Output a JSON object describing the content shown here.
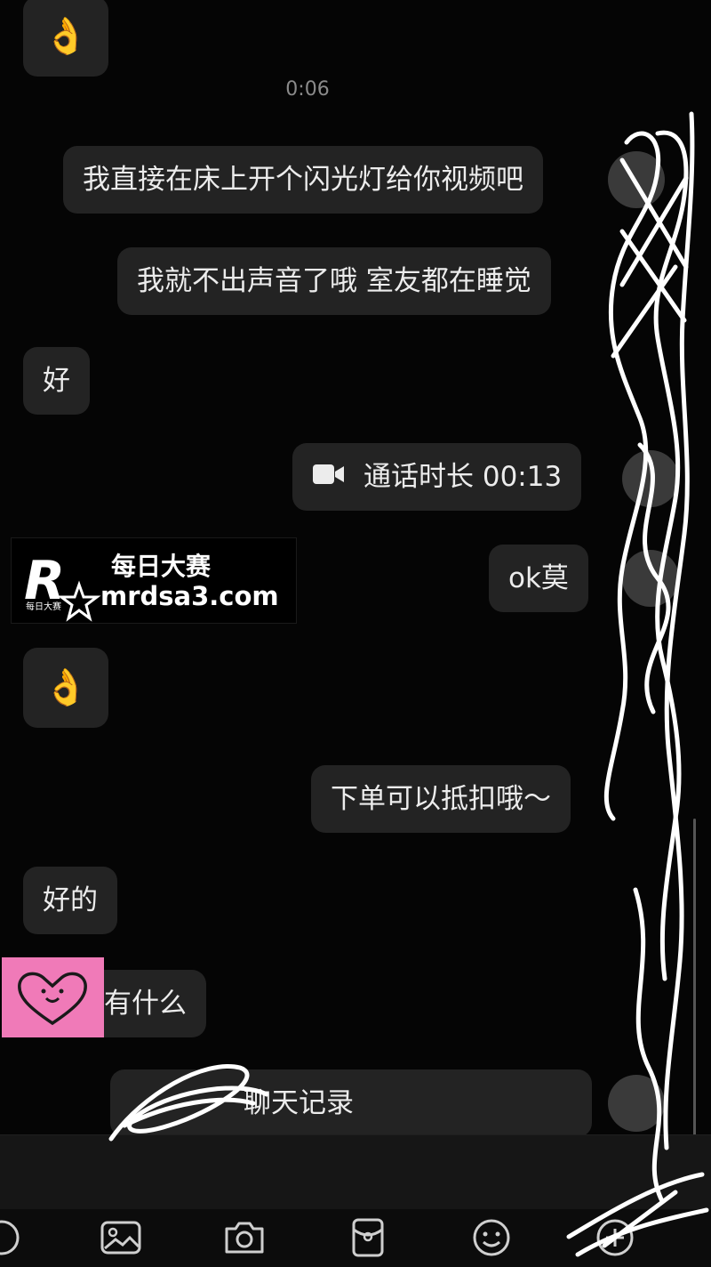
{
  "chat": {
    "timestamp": "0:06",
    "messages": {
      "m1": "我直接在床上开个闪光灯给你视频吧",
      "m2": "我就不出声音了哦 室友都在睡觉",
      "m3": "好",
      "m4": "通话时长 00:13",
      "m5": "ok莫",
      "m6": "下单可以抵扣哦～",
      "m7": "好的",
      "m8": "有什么",
      "m9": "聊天记录"
    },
    "emoji": {
      "ok_hand": "👌"
    }
  },
  "watermark": {
    "logo_letter": "R",
    "logo_small": "每日大赛",
    "brand": "每日大赛",
    "site": "mrdsa3.com"
  },
  "toolbar": {
    "icons": [
      "voice-icon",
      "image-icon",
      "camera-icon",
      "red-packet-icon",
      "emoji-icon",
      "plus-icon"
    ]
  },
  "colors": {
    "background": "#050505",
    "bubble": "#232323",
    "text": "#ececec",
    "sticker": "#f07ab8",
    "scribble": "#ffffff"
  }
}
